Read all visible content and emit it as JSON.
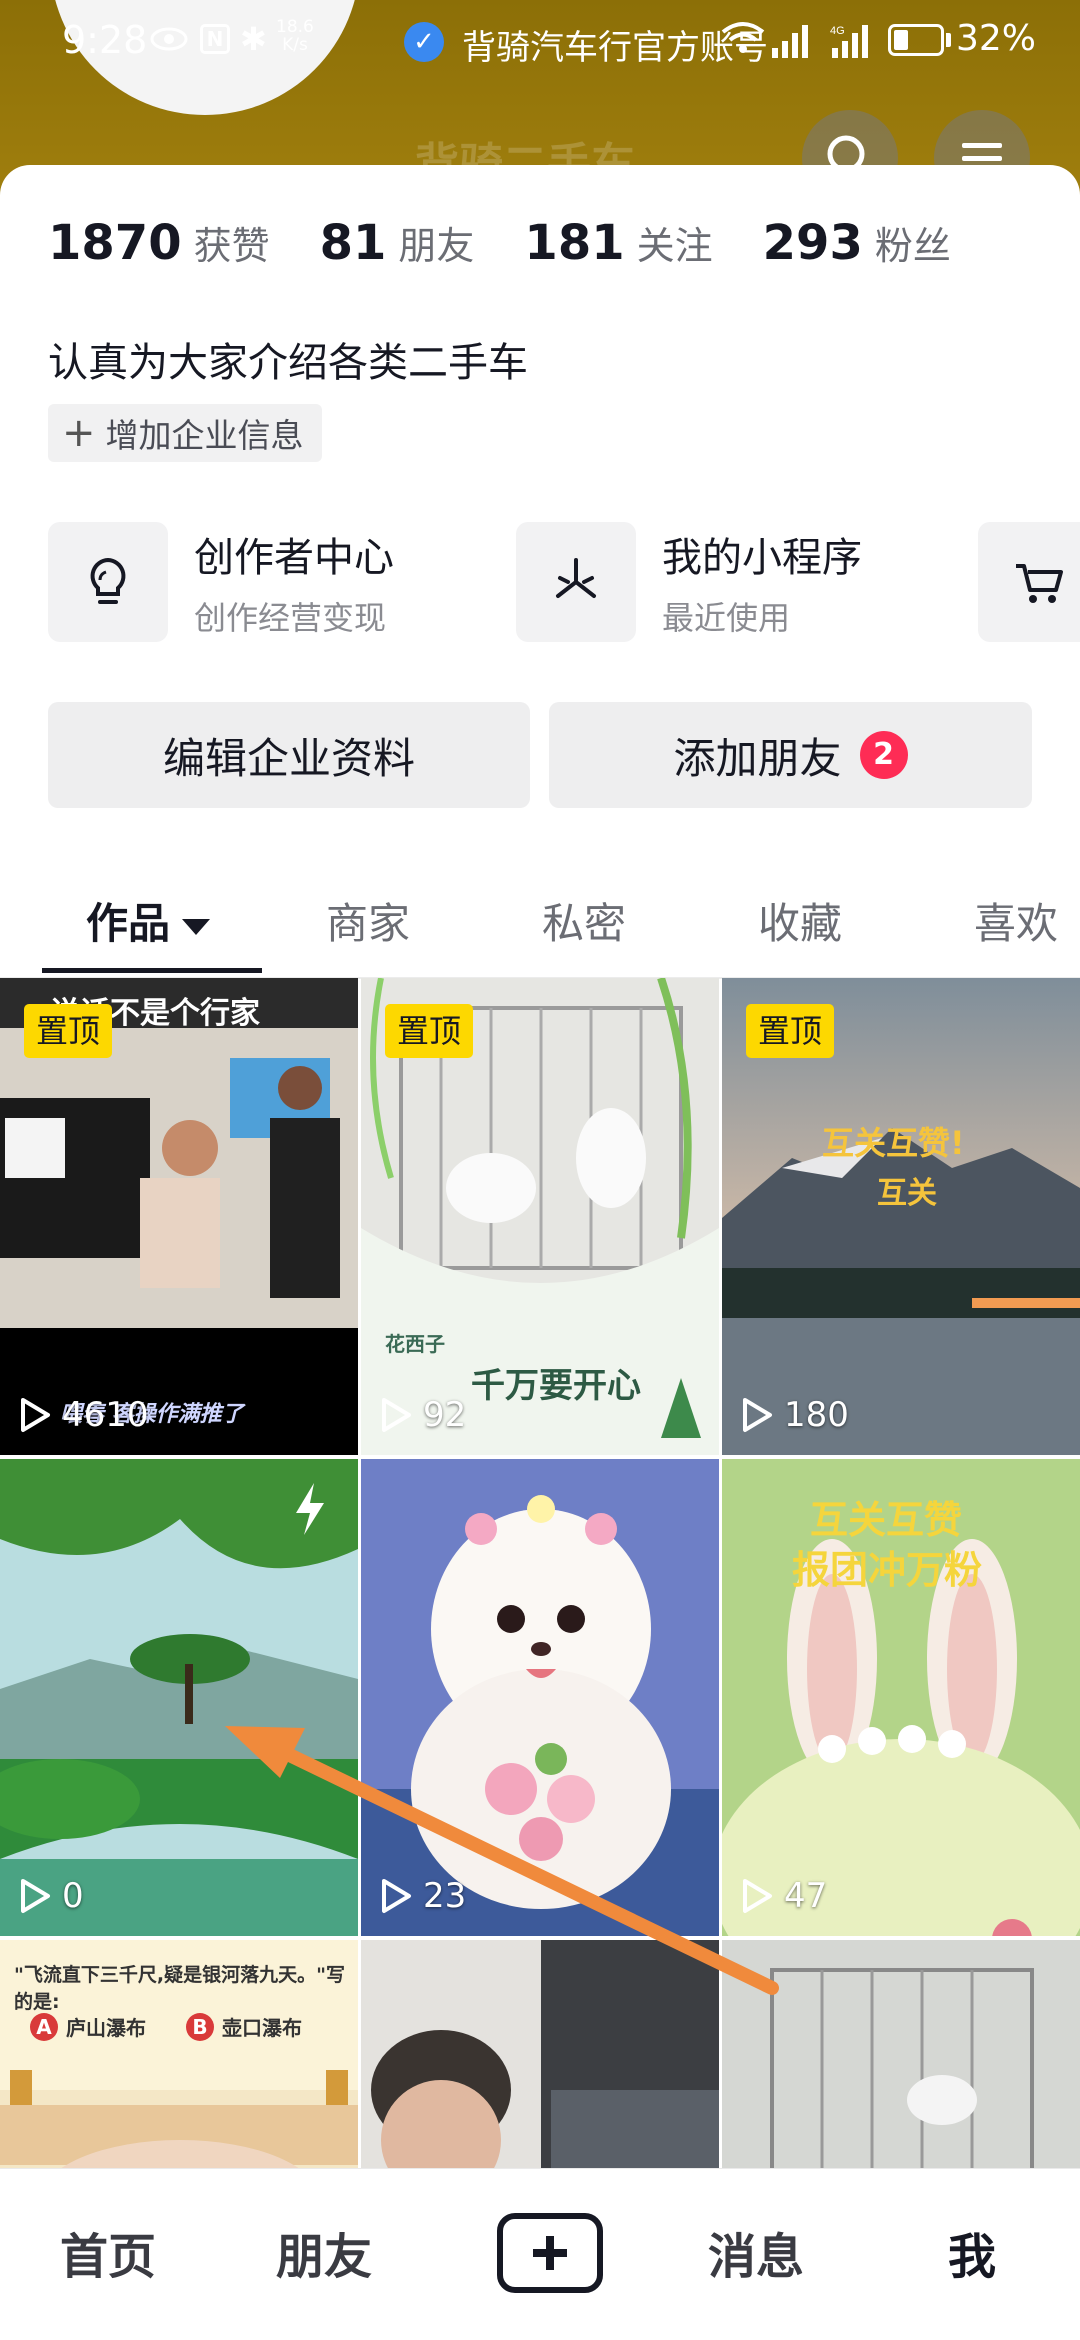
{
  "status_bar": {
    "time": "9:28",
    "net_speed_value": "18.6",
    "net_speed_unit": "K/s",
    "battery_percent": "32%",
    "battery_level": 0.32,
    "signal_label": "4G"
  },
  "header": {
    "account_name": "背骑汽车行官方账号",
    "ghost_title": "背骑二手车"
  },
  "stats": [
    {
      "num": "1870",
      "label": "获赞"
    },
    {
      "num": "81",
      "label": "朋友"
    },
    {
      "num": "181",
      "label": "关注"
    },
    {
      "num": "293",
      "label": "粉丝"
    }
  ],
  "bio": "认真为大家介绍各类二手车",
  "add_info_label": "增加企业信息",
  "features": [
    {
      "title": "创作者中心",
      "sub": "创作经营变现",
      "icon": "lightbulb-icon"
    },
    {
      "title": "我的小程序",
      "sub": "最近使用",
      "icon": "asterisk-icon"
    },
    {
      "title": "",
      "sub": "",
      "icon": "cart-icon"
    }
  ],
  "actions": {
    "edit_label": "编辑企业资料",
    "add_friend_label": "添加朋友",
    "add_friend_badge": "2"
  },
  "tabs": [
    "作品",
    "商家",
    "私密",
    "收藏",
    "喜欢"
  ],
  "grid": {
    "pin_label": "置顶",
    "items": [
      {
        "plays": "4610",
        "overlay": "说话不是个行家",
        "caption": "喂春 客操作满推了"
      },
      {
        "plays": "92",
        "overlay": "千万要开心",
        "caption": "花西子"
      },
      {
        "plays": "180",
        "overlay": "互关互赞!",
        "overlay2": "互关"
      },
      {
        "plays": "0"
      },
      {
        "plays": "23"
      },
      {
        "plays": "47",
        "overlay": "互关互赞",
        "overlay2": "报团冲万粉"
      },
      {
        "overlay": "\"飞流直下三千尺,疑是银河落九天。\"写的是:",
        "opt_a_label": "A",
        "opt_a": "庐山瀑布",
        "opt_b_label": "B",
        "opt_b": "壶口瀑布"
      },
      {},
      {}
    ]
  },
  "bottom_nav": [
    "首页",
    "朋友",
    "消息",
    "我"
  ],
  "colors": {
    "header_bg": "#8c6f07",
    "pin_yellow": "#fdd800",
    "badge_red": "#fe2c55",
    "verified_blue": "#3a89f0",
    "arrow_orange": "#f08a3c"
  }
}
